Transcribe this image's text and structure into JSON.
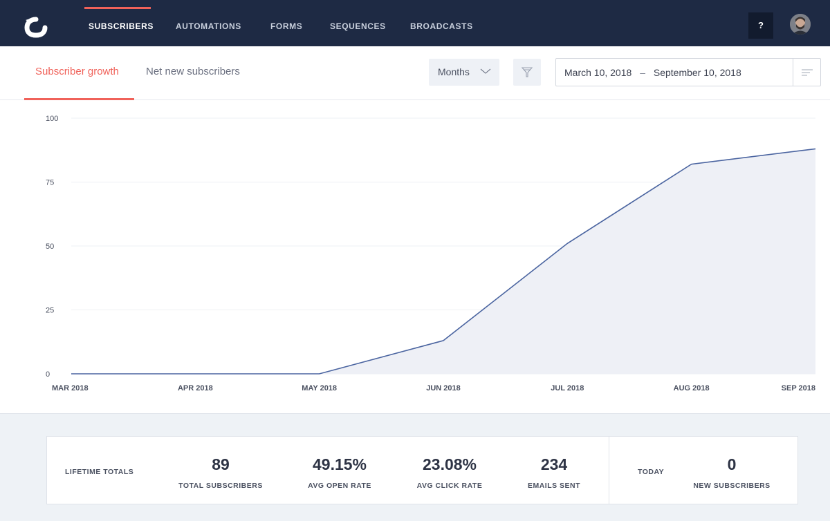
{
  "nav": {
    "items": [
      {
        "label": "SUBSCRIBERS",
        "active": true
      },
      {
        "label": "AUTOMATIONS",
        "active": false
      },
      {
        "label": "FORMS",
        "active": false
      },
      {
        "label": "SEQUENCES",
        "active": false
      },
      {
        "label": "BROADCASTS",
        "active": false
      }
    ],
    "help_label": "?"
  },
  "toolbar": {
    "tabs": [
      {
        "label": "Subscriber growth",
        "active": true
      },
      {
        "label": "Net new subscribers",
        "active": false
      }
    ],
    "period_select": "Months",
    "date_start": "March 10, 2018",
    "date_separator": "–",
    "date_end": "September 10, 2018"
  },
  "chart_data": {
    "type": "area",
    "categories": [
      "MAR 2018",
      "APR 2018",
      "MAY 2018",
      "JUN 2018",
      "JUL 2018",
      "AUG 2018",
      "SEP 2018"
    ],
    "series": [
      {
        "values": [
          0,
          0,
          0,
          13,
          51,
          82,
          88
        ]
      }
    ],
    "yticks": [
      "0",
      "25",
      "50",
      "75",
      "100"
    ],
    "ylim": [
      0,
      100
    ],
    "grid": true,
    "colors": {
      "line": "#4a64a0",
      "fill": "#eef0f6"
    }
  },
  "stats": {
    "lifetime_heading": "LIFETIME TOTALS",
    "items": [
      {
        "value": "89",
        "label": "TOTAL SUBSCRIBERS"
      },
      {
        "value": "49.15%",
        "label": "AVG OPEN RATE"
      },
      {
        "value": "23.08%",
        "label": "AVG CLICK RATE"
      },
      {
        "value": "234",
        "label": "EMAILS SENT"
      }
    ],
    "today_heading": "TODAY",
    "today": {
      "value": "0",
      "label": "NEW SUBSCRIBERS"
    }
  },
  "colors": {
    "nav_bg": "#1e2a44",
    "accent": "#f0625a",
    "bottom_bg": "#eef2f6"
  }
}
